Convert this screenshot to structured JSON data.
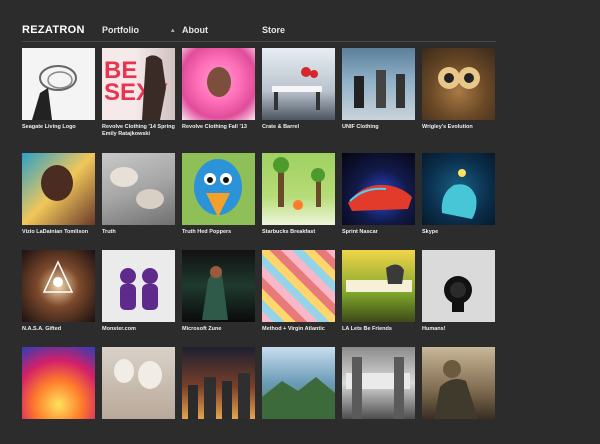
{
  "header": {
    "logo": "REZATRON",
    "nav": {
      "portfolio": "Portfolio",
      "about": "About",
      "store": "Store"
    }
  },
  "tiles": [
    {
      "caption": "Seagate Living Logo"
    },
    {
      "caption": "Revolve Clothing '14 Spring Emily Ratajkowski",
      "overlay_text": "BE SEXY"
    },
    {
      "caption": "Revolve Clothing Fall '13"
    },
    {
      "caption": "Crate & Barrel"
    },
    {
      "caption": "UNIF Clothing"
    },
    {
      "caption": "Wrigley's Evolution"
    },
    {
      "caption": "Vizio LaDainian Tomlison"
    },
    {
      "caption": "Truth"
    },
    {
      "caption": "Truth Hed Poppers"
    },
    {
      "caption": "Starbucks Breakfast"
    },
    {
      "caption": "Sprint Nascar"
    },
    {
      "caption": "Skype"
    },
    {
      "caption": "N.A.S.A. Gifted"
    },
    {
      "caption": "Monster.com"
    },
    {
      "caption": "Microsoft Zune"
    },
    {
      "caption": "Method + Virgin Atlantic"
    },
    {
      "caption": "LA Lets Be Friends"
    },
    {
      "caption": "Humans!"
    },
    {
      "caption": ""
    },
    {
      "caption": ""
    },
    {
      "caption": ""
    },
    {
      "caption": ""
    },
    {
      "caption": ""
    },
    {
      "caption": ""
    }
  ],
  "colors": {
    "background": "#2c2c2c",
    "text": "#ffffff",
    "divider": "#4a4a4a"
  },
  "icons": {
    "portfolio_dropdown": "caret-icon"
  }
}
